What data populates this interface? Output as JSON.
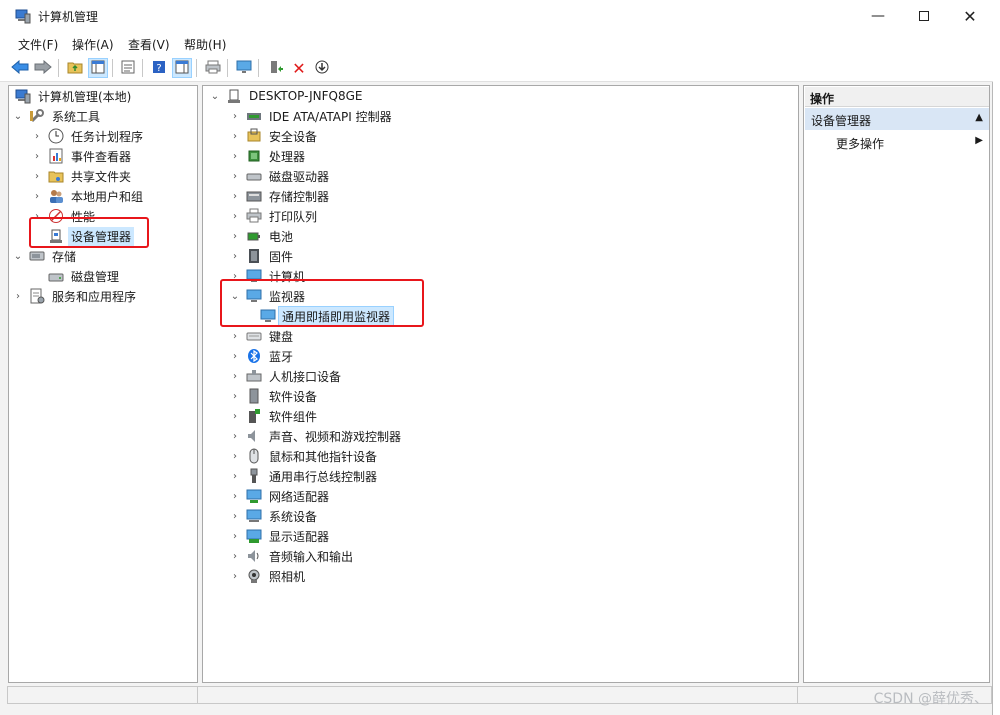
{
  "window": {
    "title": "计算机管理",
    "controls": [
      "minimize-icon",
      "maximize-icon",
      "close-icon"
    ]
  },
  "menubar": {
    "items": [
      "文件(F)",
      "操作(A)",
      "查看(V)",
      "帮助(H)"
    ]
  },
  "toolbar": {
    "icons": [
      "back-arrow-icon",
      "forward-arrow-icon",
      "up-folder-icon",
      "show-hide-tree-icon",
      "properties-icon",
      "help-icon",
      "show-hide-action-pane-icon",
      "print-icon",
      "monitor-scan-icon",
      "update-driver-icon",
      "uninstall-icon",
      "disable-device-icon"
    ]
  },
  "left_tree": {
    "root": "计算机管理(本地)",
    "system_tools": "系统工具",
    "task_scheduler": "任务计划程序",
    "event_viewer": "事件查看器",
    "shared_folders": "共享文件夹",
    "local_users": "本地用户和组",
    "performance": "性能",
    "device_manager": "设备管理器",
    "storage": "存储",
    "disk_management": "磁盘管理",
    "services_apps": "服务和应用程序"
  },
  "device_tree": {
    "computer_name": "DESKTOP-JNFQ8GE",
    "categories": [
      {
        "label": "IDE ATA/ATAPI 控制器",
        "icon": "ide-controller-icon"
      },
      {
        "label": "安全设备",
        "icon": "security-device-icon"
      },
      {
        "label": "处理器",
        "icon": "processor-icon"
      },
      {
        "label": "磁盘驱动器",
        "icon": "disk-drive-icon"
      },
      {
        "label": "存储控制器",
        "icon": "storage-controller-icon"
      },
      {
        "label": "打印队列",
        "icon": "printer-icon"
      },
      {
        "label": "电池",
        "icon": "battery-icon"
      },
      {
        "label": "固件",
        "icon": "firmware-icon"
      },
      {
        "label": "计算机",
        "icon": "computer-icon"
      },
      {
        "label": "监视器",
        "icon": "monitor-icon",
        "expanded": true
      },
      {
        "label": "键盘",
        "icon": "keyboard-icon"
      },
      {
        "label": "蓝牙",
        "icon": "bluetooth-icon"
      },
      {
        "label": "人机接口设备",
        "icon": "hid-icon"
      },
      {
        "label": "软件设备",
        "icon": "software-device-icon"
      },
      {
        "label": "软件组件",
        "icon": "software-component-icon"
      },
      {
        "label": "声音、视频和游戏控制器",
        "icon": "sound-icon"
      },
      {
        "label": "鼠标和其他指针设备",
        "icon": "mouse-icon"
      },
      {
        "label": "通用串行总线控制器",
        "icon": "usb-icon"
      },
      {
        "label": "网络适配器",
        "icon": "network-adapter-icon"
      },
      {
        "label": "系统设备",
        "icon": "system-device-icon"
      },
      {
        "label": "显示适配器",
        "icon": "display-adapter-icon"
      },
      {
        "label": "音频输入和输出",
        "icon": "audio-io-icon"
      },
      {
        "label": "照相机",
        "icon": "camera-icon"
      }
    ],
    "monitor_child": "通用即插即用监视器"
  },
  "actions_pane": {
    "header": "操作",
    "section": "设备管理器",
    "more_actions": "更多操作"
  },
  "watermark": "CSDN @薛优秀、",
  "colors": {
    "highlight_box": "#e8161b",
    "selection": "#cce8ff",
    "action_section": "#d9e6f5"
  }
}
